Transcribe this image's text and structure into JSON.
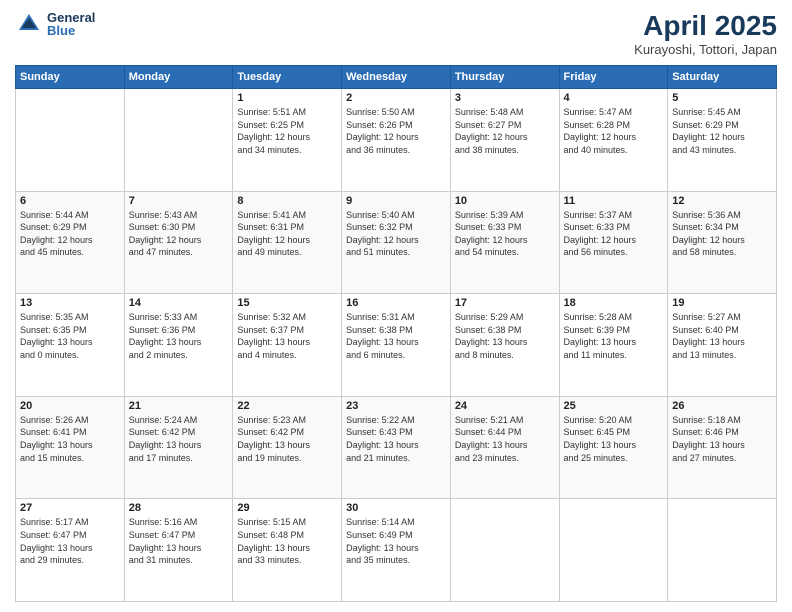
{
  "header": {
    "logo_general": "General",
    "logo_blue": "Blue",
    "title": "April 2025",
    "subtitle": "Kurayoshi, Tottori, Japan"
  },
  "days_of_week": [
    "Sunday",
    "Monday",
    "Tuesday",
    "Wednesday",
    "Thursday",
    "Friday",
    "Saturday"
  ],
  "weeks": [
    [
      {
        "day": "",
        "info": ""
      },
      {
        "day": "",
        "info": ""
      },
      {
        "day": "1",
        "info": "Sunrise: 5:51 AM\nSunset: 6:25 PM\nDaylight: 12 hours\nand 34 minutes."
      },
      {
        "day": "2",
        "info": "Sunrise: 5:50 AM\nSunset: 6:26 PM\nDaylight: 12 hours\nand 36 minutes."
      },
      {
        "day": "3",
        "info": "Sunrise: 5:48 AM\nSunset: 6:27 PM\nDaylight: 12 hours\nand 38 minutes."
      },
      {
        "day": "4",
        "info": "Sunrise: 5:47 AM\nSunset: 6:28 PM\nDaylight: 12 hours\nand 40 minutes."
      },
      {
        "day": "5",
        "info": "Sunrise: 5:45 AM\nSunset: 6:29 PM\nDaylight: 12 hours\nand 43 minutes."
      }
    ],
    [
      {
        "day": "6",
        "info": "Sunrise: 5:44 AM\nSunset: 6:29 PM\nDaylight: 12 hours\nand 45 minutes."
      },
      {
        "day": "7",
        "info": "Sunrise: 5:43 AM\nSunset: 6:30 PM\nDaylight: 12 hours\nand 47 minutes."
      },
      {
        "day": "8",
        "info": "Sunrise: 5:41 AM\nSunset: 6:31 PM\nDaylight: 12 hours\nand 49 minutes."
      },
      {
        "day": "9",
        "info": "Sunrise: 5:40 AM\nSunset: 6:32 PM\nDaylight: 12 hours\nand 51 minutes."
      },
      {
        "day": "10",
        "info": "Sunrise: 5:39 AM\nSunset: 6:33 PM\nDaylight: 12 hours\nand 54 minutes."
      },
      {
        "day": "11",
        "info": "Sunrise: 5:37 AM\nSunset: 6:33 PM\nDaylight: 12 hours\nand 56 minutes."
      },
      {
        "day": "12",
        "info": "Sunrise: 5:36 AM\nSunset: 6:34 PM\nDaylight: 12 hours\nand 58 minutes."
      }
    ],
    [
      {
        "day": "13",
        "info": "Sunrise: 5:35 AM\nSunset: 6:35 PM\nDaylight: 13 hours\nand 0 minutes."
      },
      {
        "day": "14",
        "info": "Sunrise: 5:33 AM\nSunset: 6:36 PM\nDaylight: 13 hours\nand 2 minutes."
      },
      {
        "day": "15",
        "info": "Sunrise: 5:32 AM\nSunset: 6:37 PM\nDaylight: 13 hours\nand 4 minutes."
      },
      {
        "day": "16",
        "info": "Sunrise: 5:31 AM\nSunset: 6:38 PM\nDaylight: 13 hours\nand 6 minutes."
      },
      {
        "day": "17",
        "info": "Sunrise: 5:29 AM\nSunset: 6:38 PM\nDaylight: 13 hours\nand 8 minutes."
      },
      {
        "day": "18",
        "info": "Sunrise: 5:28 AM\nSunset: 6:39 PM\nDaylight: 13 hours\nand 11 minutes."
      },
      {
        "day": "19",
        "info": "Sunrise: 5:27 AM\nSunset: 6:40 PM\nDaylight: 13 hours\nand 13 minutes."
      }
    ],
    [
      {
        "day": "20",
        "info": "Sunrise: 5:26 AM\nSunset: 6:41 PM\nDaylight: 13 hours\nand 15 minutes."
      },
      {
        "day": "21",
        "info": "Sunrise: 5:24 AM\nSunset: 6:42 PM\nDaylight: 13 hours\nand 17 minutes."
      },
      {
        "day": "22",
        "info": "Sunrise: 5:23 AM\nSunset: 6:42 PM\nDaylight: 13 hours\nand 19 minutes."
      },
      {
        "day": "23",
        "info": "Sunrise: 5:22 AM\nSunset: 6:43 PM\nDaylight: 13 hours\nand 21 minutes."
      },
      {
        "day": "24",
        "info": "Sunrise: 5:21 AM\nSunset: 6:44 PM\nDaylight: 13 hours\nand 23 minutes."
      },
      {
        "day": "25",
        "info": "Sunrise: 5:20 AM\nSunset: 6:45 PM\nDaylight: 13 hours\nand 25 minutes."
      },
      {
        "day": "26",
        "info": "Sunrise: 5:18 AM\nSunset: 6:46 PM\nDaylight: 13 hours\nand 27 minutes."
      }
    ],
    [
      {
        "day": "27",
        "info": "Sunrise: 5:17 AM\nSunset: 6:47 PM\nDaylight: 13 hours\nand 29 minutes."
      },
      {
        "day": "28",
        "info": "Sunrise: 5:16 AM\nSunset: 6:47 PM\nDaylight: 13 hours\nand 31 minutes."
      },
      {
        "day": "29",
        "info": "Sunrise: 5:15 AM\nSunset: 6:48 PM\nDaylight: 13 hours\nand 33 minutes."
      },
      {
        "day": "30",
        "info": "Sunrise: 5:14 AM\nSunset: 6:49 PM\nDaylight: 13 hours\nand 35 minutes."
      },
      {
        "day": "",
        "info": ""
      },
      {
        "day": "",
        "info": ""
      },
      {
        "day": "",
        "info": ""
      }
    ]
  ]
}
